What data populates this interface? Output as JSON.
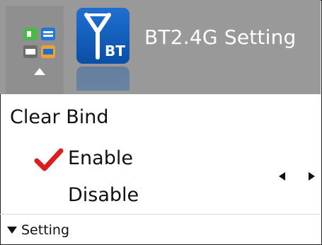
{
  "header": {
    "title": "BT2.4G Setting",
    "app_icon": "bt-2.4g-antenna-icon",
    "app_icon_text": "BT",
    "menu_icon": "apps-grid-icon",
    "nav_icon": "up-arrow-icon"
  },
  "setting": {
    "label": "Clear Bind",
    "options": [
      {
        "label": "Enable",
        "selected": true
      },
      {
        "label": "Disable",
        "selected": false
      }
    ],
    "selected_marker_icon": "checkmark-icon",
    "prev_icon": "arrow-left-icon",
    "next_icon": "arrow-right-icon"
  },
  "footer": {
    "label": "Setting",
    "icon": "triangle-down-icon"
  },
  "colors": {
    "header_bg": "#999999",
    "tile_bg": "#8f8f8f",
    "icon_blue": "#0f5fbf",
    "check_red": "#d91f1f",
    "text": "#111111"
  }
}
